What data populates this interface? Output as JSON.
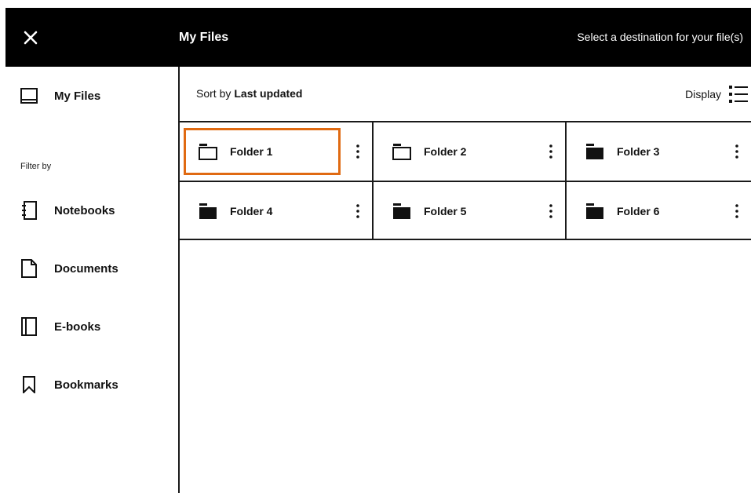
{
  "header": {
    "close_icon": "close-icon",
    "title": "My Files",
    "hint": "Select a destination for your file(s)"
  },
  "sidebar": {
    "my_files": {
      "label": "My Files",
      "icon": "tray-icon"
    },
    "filter_label": "Filter by",
    "filters": [
      {
        "label": "Notebooks",
        "icon": "notebook-icon"
      },
      {
        "label": "Documents",
        "icon": "document-icon"
      },
      {
        "label": "E-books",
        "icon": "ebook-icon"
      },
      {
        "label": "Bookmarks",
        "icon": "bookmark-icon"
      }
    ]
  },
  "toolbar": {
    "sort_prefix": "Sort by",
    "sort_value": "Last updated",
    "display_label": "Display",
    "display_icon": "list-view-icon"
  },
  "folders": [
    {
      "label": "Folder 1",
      "style": "outline",
      "selected": true
    },
    {
      "label": "Folder 2",
      "style": "outline",
      "selected": false
    },
    {
      "label": "Folder 3",
      "style": "filled",
      "selected": false
    },
    {
      "label": "Folder 4",
      "style": "filled",
      "selected": false
    },
    {
      "label": "Folder 5",
      "style": "filled",
      "selected": false
    },
    {
      "label": "Folder 6",
      "style": "filled",
      "selected": false
    }
  ],
  "colors": {
    "header_bg": "#000000",
    "selection": "#e06a12"
  }
}
